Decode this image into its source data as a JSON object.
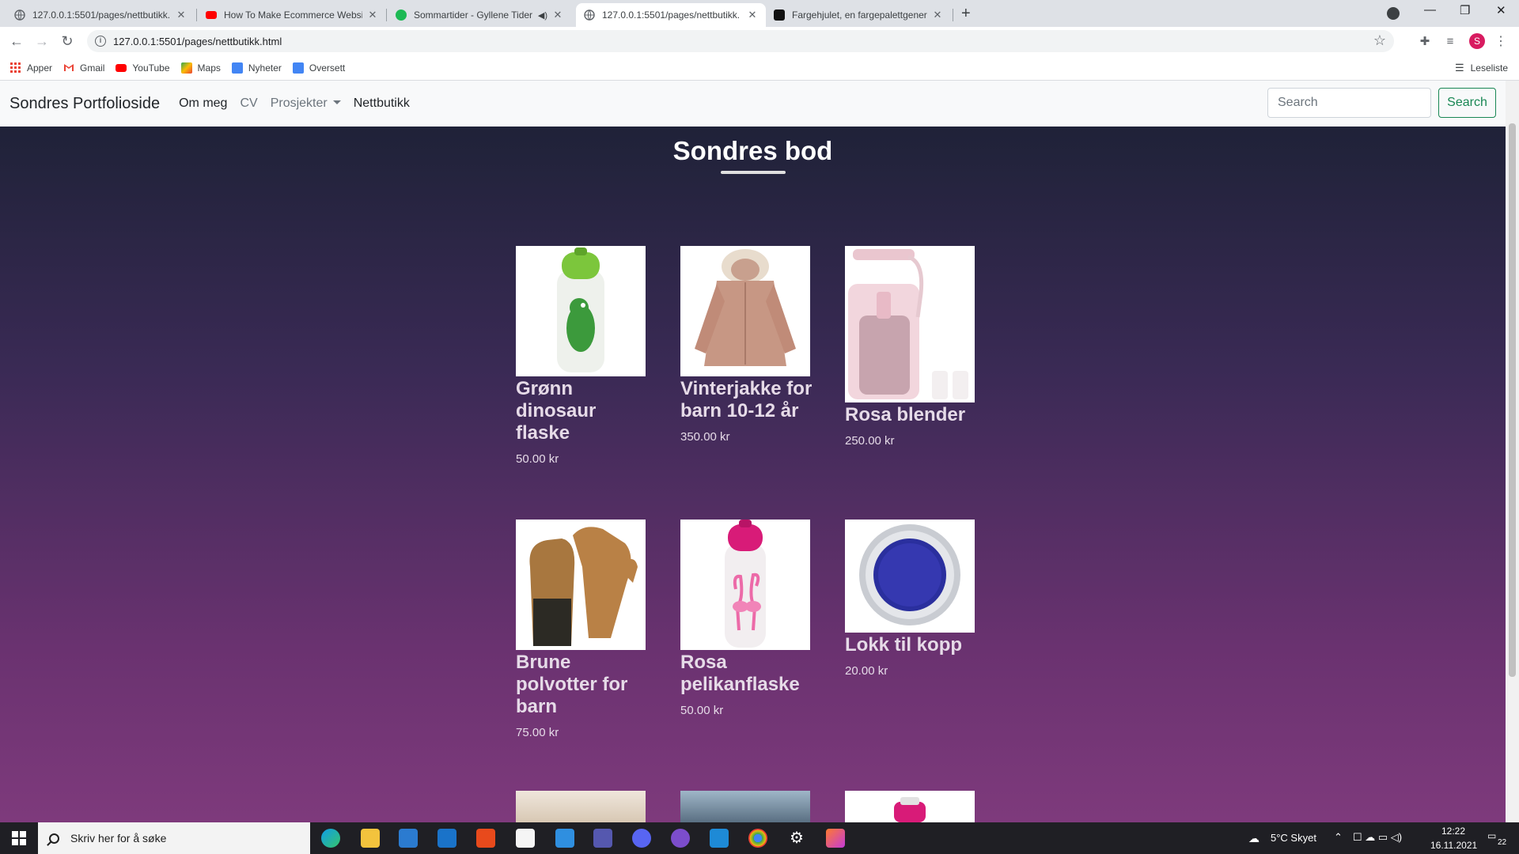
{
  "browser": {
    "tabs": [
      {
        "title": "127.0.0.1:5501/pages/nettbutikk.",
        "active": false
      },
      {
        "title": "How To Make Ecommerce Websi",
        "active": false
      },
      {
        "title": "Sommartider - Gyllene Tider",
        "active": false
      },
      {
        "title": "127.0.0.1:5501/pages/nettbutikk.",
        "active": true
      },
      {
        "title": "Fargehjulet, en fargepalettgenera",
        "active": false
      }
    ],
    "url": "127.0.0.1:5501/pages/nettbutikk.html",
    "avatar_letter": "S",
    "bookmarks": [
      "Apper",
      "Gmail",
      "YouTube",
      "Maps",
      "Nyheter",
      "Oversett"
    ],
    "reading_list": "Leseliste"
  },
  "site": {
    "brand": "Sondres Portfolioside",
    "nav": [
      "Om meg",
      "CV",
      "Prosjekter",
      "Nettbutikk"
    ],
    "search_placeholder": "Search",
    "search_button": "Search"
  },
  "shop": {
    "title": "Sondres bod",
    "products": [
      {
        "name": "Grønn dinosaur flaske",
        "price": "50.00 kr",
        "image": "green-dino-bottle"
      },
      {
        "name": "Vinterjakke for barn 10-12 år",
        "price": "350.00 kr",
        "image": "winter-jacket"
      },
      {
        "name": "Rosa blender",
        "price": "250.00 kr",
        "image": "pink-blender"
      },
      {
        "name": "Brune polvotter for barn",
        "price": "75.00 kr",
        "image": "brown-mittens"
      },
      {
        "name": "Rosa pelikanflaske",
        "price": "50.00 kr",
        "image": "pink-flamingo-bottle"
      },
      {
        "name": "Lokk til kopp",
        "price": "20.00 kr",
        "image": "cup-lid"
      }
    ]
  },
  "taskbar": {
    "search_placeholder": "Skriv her for å søke",
    "weather": "5°C  Skyet",
    "time": "12:22",
    "date": "16.11.2021",
    "notifications": "22"
  }
}
